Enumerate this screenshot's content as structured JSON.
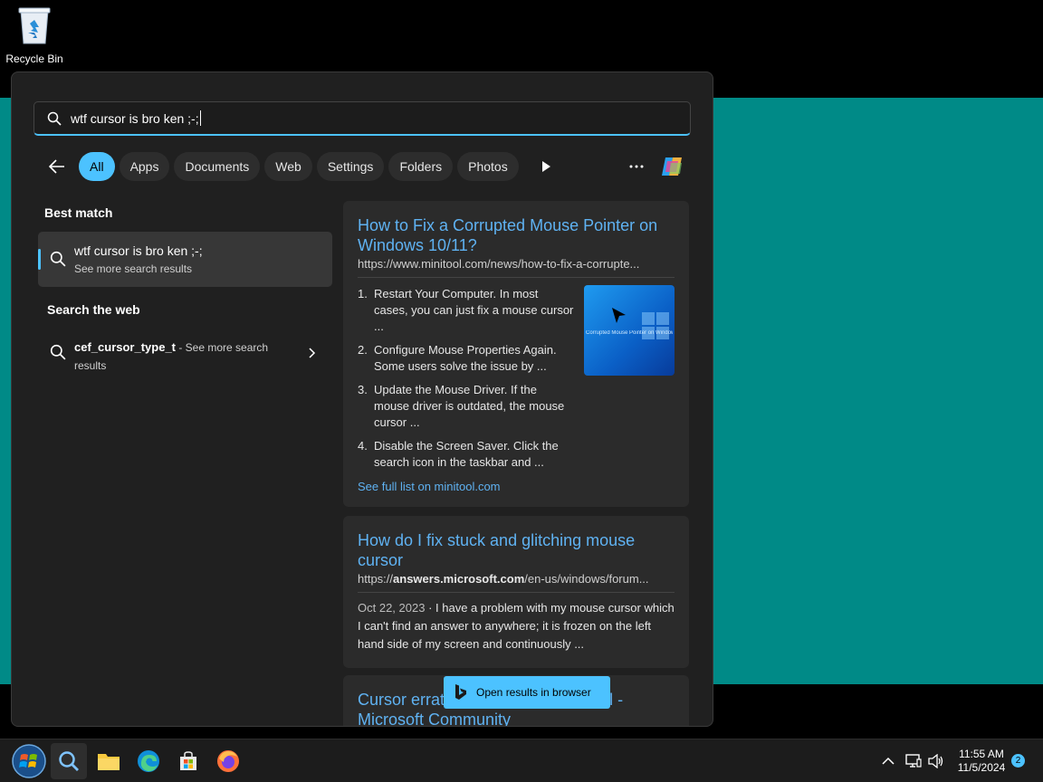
{
  "desktop": {
    "recycle_bin_label": "Recycle Bin"
  },
  "search": {
    "query": "wtf cursor is bro ken ;-;"
  },
  "filters": [
    {
      "label": "All",
      "active": true
    },
    {
      "label": "Apps"
    },
    {
      "label": "Documents"
    },
    {
      "label": "Web"
    },
    {
      "label": "Settings"
    },
    {
      "label": "Folders"
    },
    {
      "label": "Photos"
    }
  ],
  "left": {
    "best_match_title": "Best match",
    "best_match": {
      "title": "wtf cursor is bro ken ;-;",
      "subtitle": "See more search results"
    },
    "search_web_title": "Search the web",
    "web_item": {
      "term": "cef_cursor_type_t",
      "suffix": " - See more search results"
    }
  },
  "results": [
    {
      "title": "How to Fix a Corrupted Mouse Pointer on Windows 10/11?",
      "url": "https://www.minitool.com/news/how-to-fix-a-corrupte...",
      "steps": [
        {
          "n": "1.",
          "text": "Restart Your Computer. In most cases, you can just fix a mouse cursor ..."
        },
        {
          "n": "2.",
          "text": "Configure Mouse Properties Again. Some users solve the issue by ..."
        },
        {
          "n": "3.",
          "text": "Update the Mouse Driver. If the mouse driver is outdated, the mouse cursor ..."
        },
        {
          "n": "4.",
          "text": "Disable the Screen Saver. Click the search icon in the taskbar and ..."
        }
      ],
      "thumb_caption": "Corrupted Mouse Pointer on Windows 10/11",
      "see_full": "See full list on minitool.com"
    },
    {
      "title": "How do I fix stuck and glitching mouse cursor",
      "url_prefix": "https://",
      "url_bold": "answers.microsoft.com",
      "url_suffix": "/en-us/windows/forum...",
      "date": "Oct 22, 2023",
      "snippet": " · I have a problem with my mouse cursor which I can't find an answer to anywhere; it is frozen on the left hand side of my screen and continuously ..."
    },
    {
      "title": "Cursor erratic mouse cursor control - Microsoft Community"
    }
  ],
  "open_browser_label": "Open results in browser",
  "taskbar": {
    "time": "11:55 AM",
    "date": "11/5/2024",
    "notification_count": "2"
  },
  "colors": {
    "accent": "#4cc2ff",
    "link": "#5fb2f2",
    "desktop": "#008a87",
    "panel": "#202020"
  }
}
